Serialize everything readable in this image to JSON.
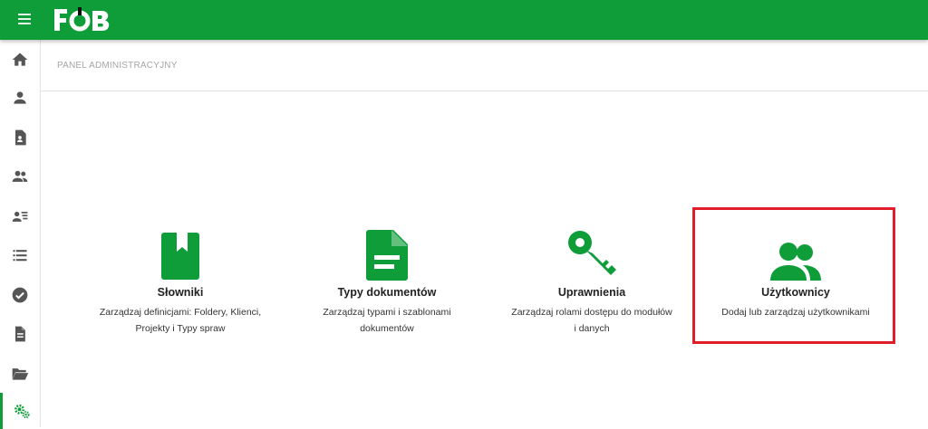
{
  "app": {
    "logo_text": "FOB",
    "brand_color": "#0f9d3a",
    "accent_color": "#0f9d3a"
  },
  "header": {
    "menu_icon": "hamburger-icon"
  },
  "sidebar": {
    "items": [
      {
        "icon": "home-icon",
        "active": false
      },
      {
        "icon": "person-icon",
        "active": false
      },
      {
        "icon": "contact-document-icon",
        "active": false
      },
      {
        "icon": "people-icon",
        "active": false
      },
      {
        "icon": "person-list-icon",
        "active": false
      },
      {
        "icon": "list-icon",
        "active": false
      },
      {
        "icon": "check-circle-icon",
        "active": false
      },
      {
        "icon": "document-icon",
        "active": false
      },
      {
        "icon": "folder-open-icon",
        "active": false
      },
      {
        "icon": "settings-gears-icon",
        "active": true
      }
    ]
  },
  "breadcrumb": "PANEL ADMINISTRACYJNY",
  "tiles": [
    {
      "icon": "bookmark-book-icon",
      "title": "Słowniki",
      "description": "Zarządzaj definicjami: Foldery, Klienci, Projekty i Typy spraw"
    },
    {
      "icon": "document-text-icon",
      "title": "Typy dokumentów",
      "description": "Zarządzaj typami i szablonami dokumentów"
    },
    {
      "icon": "key-icon",
      "title": "Uprawnienia",
      "description": "Zarządzaj rolami dostępu do modułów i danych"
    },
    {
      "icon": "people-icon",
      "title": "Użytkownicy",
      "description": "Dodaj lub zarządzaj użytkownikami",
      "highlighted": true
    }
  ],
  "highlight_color": "#e01e2a"
}
